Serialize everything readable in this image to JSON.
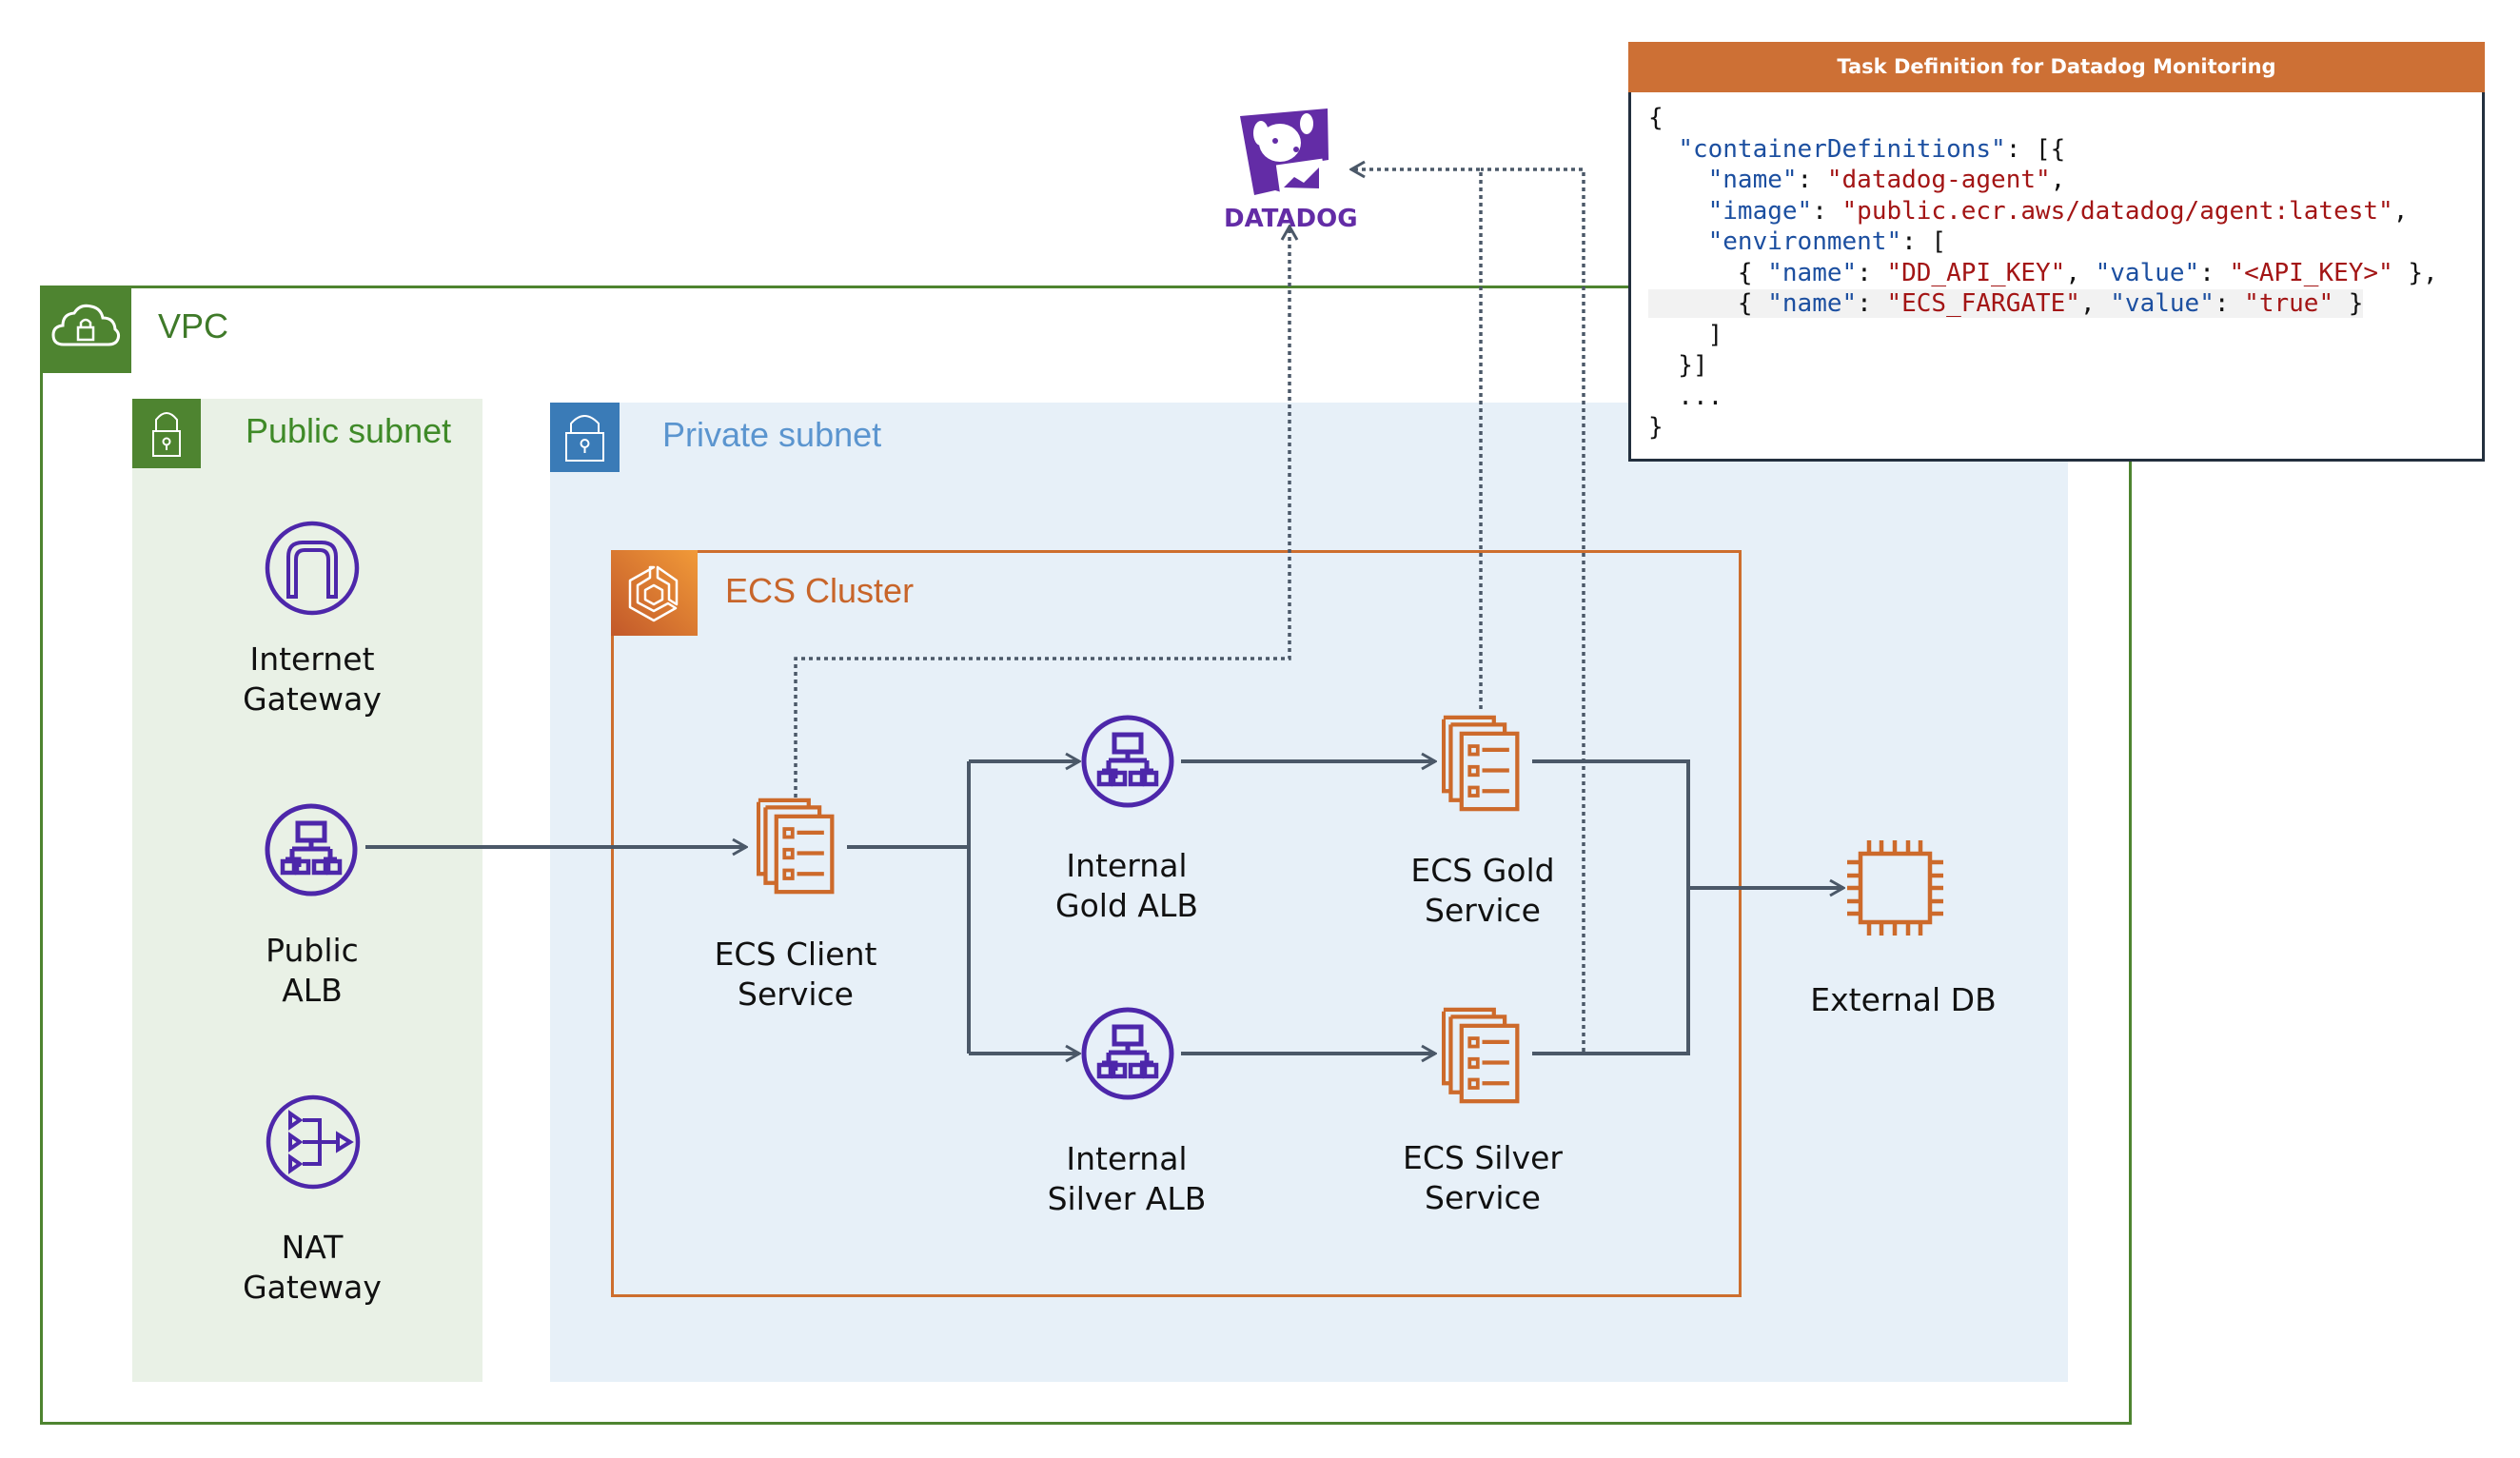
{
  "containers": {
    "vpc": {
      "label": "VPC",
      "icon": "cloud-lock-icon",
      "color": "#4e8430"
    },
    "public_subnet": {
      "label": "Public subnet",
      "icon": "lock-icon",
      "color": "#4e8430"
    },
    "private_subnet": {
      "label": "Private subnet",
      "icon": "lock-icon",
      "color": "#3a7bb7"
    },
    "ecs_cluster": {
      "label": "ECS Cluster",
      "icon": "ecs-icon",
      "color": "#cd6e2e"
    }
  },
  "nodes": {
    "internet_gateway": {
      "label": "Internet\nGateway",
      "icon": "internet-gateway-icon"
    },
    "public_alb": {
      "label": "Public\nALB",
      "icon": "load-balancer-icon"
    },
    "nat_gateway": {
      "label": "NAT\nGateway",
      "icon": "nat-gateway-icon"
    },
    "ecs_client_service": {
      "label": "ECS Client\nService",
      "icon": "ecs-service-icon"
    },
    "internal_gold_alb": {
      "label": "Internal\nGold ALB",
      "icon": "load-balancer-icon"
    },
    "internal_silver_alb": {
      "label": "Internal\nSilver ALB",
      "icon": "load-balancer-icon"
    },
    "ecs_gold_service": {
      "label": "ECS Gold\nService",
      "icon": "ecs-service-icon"
    },
    "ecs_silver_service": {
      "label": "ECS Silver\nService",
      "icon": "ecs-service-icon"
    },
    "external_db": {
      "label": "External DB",
      "icon": "chip-icon"
    },
    "datadog": {
      "label": "DATADOG",
      "icon": "datadog-logo-icon"
    }
  },
  "edges": [
    {
      "from": "public_alb",
      "to": "ecs_client_service",
      "style": "solid"
    },
    {
      "from": "ecs_client_service",
      "to": "internal_gold_alb",
      "style": "solid"
    },
    {
      "from": "ecs_client_service",
      "to": "internal_silver_alb",
      "style": "solid"
    },
    {
      "from": "internal_gold_alb",
      "to": "ecs_gold_service",
      "style": "solid"
    },
    {
      "from": "internal_silver_alb",
      "to": "ecs_silver_service",
      "style": "solid"
    },
    {
      "from": "ecs_gold_service",
      "to": "external_db",
      "style": "solid"
    },
    {
      "from": "ecs_silver_service",
      "to": "external_db",
      "style": "solid"
    },
    {
      "from": "ecs_client_service",
      "to": "datadog",
      "style": "dotted"
    },
    {
      "from": "ecs_gold_service",
      "to": "datadog",
      "style": "dotted"
    },
    {
      "from": "ecs_silver_service",
      "to": "datadog",
      "style": "dotted"
    }
  ],
  "task_definition": {
    "title": "Task Definition for Datadog Monitoring",
    "lines": [
      "{",
      "  \"containerDefinitions\": [{",
      "    \"name\": \"datadog-agent\",",
      "    \"image\": \"public.ecr.aws/datadog/agent:latest\",",
      "    \"environment\": [",
      "      { \"name\": \"DD_API_KEY\", \"value\": \"<API_KEY>\" },",
      "      { \"name\": \"ECS_FARGATE\", \"value\": \"true\" }",
      "    ]",
      "  }]",
      "  ...",
      "}"
    ],
    "highlighted_line": 6
  },
  "colors": {
    "line": "#4b5868",
    "aws_purple": "#4d27aa",
    "aws_orange": "#cd6a2b",
    "datadog_purple": "#632ca6"
  }
}
